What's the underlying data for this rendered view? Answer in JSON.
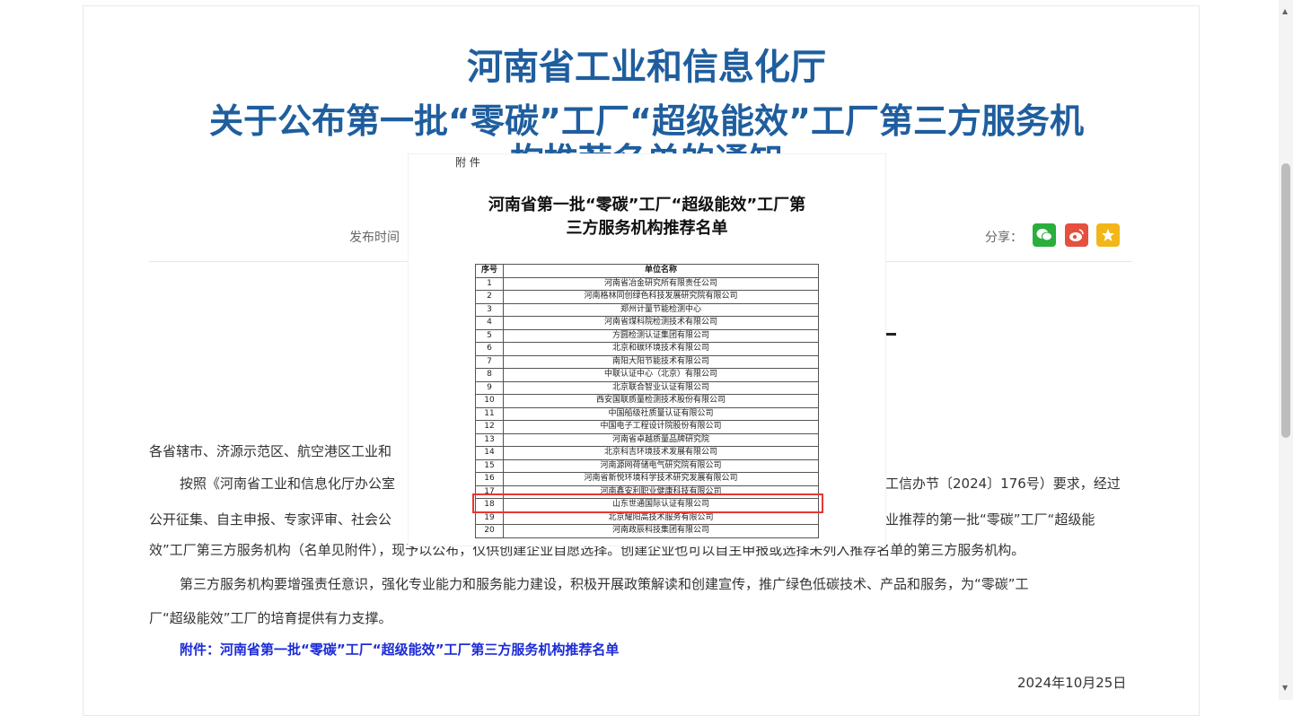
{
  "article": {
    "title_line1": "河南省工业和信息化厅",
    "title_line2": "关于公布第一批“零碳”工厂“超级能效”工厂第三方服务机",
    "title_line3": "构推荐名单的通知",
    "published_label": "发布时间",
    "share_label": "分享：",
    "para_1": "各省辖市、济源示范区、航空港区工业和",
    "para_2a": "按照《河南省工业和信息化厅办公室",
    "para_2b": "工信办节〔2024〕176号）要求，经过",
    "para_3a": "公开征集、自主申报、专家评审、社会公",
    "para_3b": "业推荐的第一批“零碳”工厂“超级能",
    "para_4": "效”工厂第三方服务机构（名单见附件），现予以公布，仅供创建企业自愿选择。创建企业也可以自主申报或选择未列入推荐名单的第三方服务机构。",
    "para_5": "第三方服务机构要增强责任意识，强化专业能力和服务能力建设，积极开展政策解读和创建宣传，推广绿色低碳技术、产品和服务，为“零碳”工",
    "para_6": "厂“超级能效”工厂的培育提供有力支撑。",
    "attachment_link": "附件：河南省第一批“零碳”工厂“超级能效”工厂第三方服务机构推荐名单",
    "date": "2024年10月25日"
  },
  "share": {
    "wechat_icon": "wechat-icon",
    "weibo_icon": "weibo-icon",
    "favorite_icon": "star-icon",
    "wechat_color": "#2aae3c",
    "weibo_color": "#e5503f",
    "favorite_color": "#f3b619"
  },
  "attachment": {
    "label": "附 件",
    "title_line1": "河南省第一批“零碳”工厂“超级能效”工厂第",
    "title_line2": "三方服务机构推荐名单",
    "table": {
      "headers": [
        "序号",
        "单位名称"
      ],
      "rows": [
        [
          "1",
          "河南省冶金研究所有限责任公司"
        ],
        [
          "2",
          "河南格林同创绿色科技发展研究院有限公司"
        ],
        [
          "3",
          "郑州计量节能检测中心"
        ],
        [
          "4",
          "河南省煤科院检测技术有限公司"
        ],
        [
          "5",
          "方圆检测认证集团有限公司"
        ],
        [
          "6",
          "北京和碳环境技术有限公司"
        ],
        [
          "7",
          "南阳大阳节能技术有限公司"
        ],
        [
          "8",
          "中联认证中心（北京）有限公司"
        ],
        [
          "9",
          "北京联合智业认证有限公司"
        ],
        [
          "10",
          "西安国联质量检测技术股份有限公司"
        ],
        [
          "11",
          "中国船级社质量认证有限公司"
        ],
        [
          "12",
          "中国电子工程设计院股份有限公司"
        ],
        [
          "13",
          "河南省卓越质量品牌研究院"
        ],
        [
          "14",
          "北京科吉环境技术发展有限公司"
        ],
        [
          "15",
          "河南源网荷储电气研究院有限公司"
        ],
        [
          "16",
          "河南省新悦环境科学技术研究发展有限公司"
        ],
        [
          "17",
          "河南鑫安利职业健康科技有限公司"
        ],
        [
          "18",
          "山东世通国际认证有限公司"
        ],
        [
          "19",
          "北京耀阳高技术服务有限公司"
        ],
        [
          "20",
          "河南政辰科技集团有限公司"
        ]
      ]
    },
    "highlight_color": "#e53935"
  }
}
